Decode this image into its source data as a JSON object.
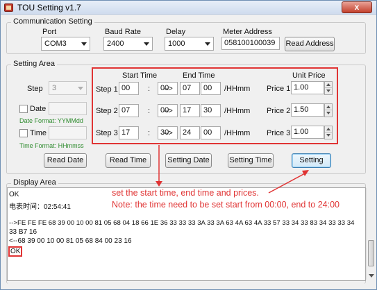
{
  "window": {
    "title": "TOU Setting v1.7",
    "close_label": "x"
  },
  "communication": {
    "legend": "Communication Setting",
    "port_label": "Port",
    "port_value": "COM3",
    "baud_label": "Baud Rate",
    "baud_value": "2400",
    "delay_label": "Delay",
    "delay_value": "1000",
    "meter_label": "Meter Address",
    "meter_value": "058100100039",
    "read_address_label": "Read Address"
  },
  "setting_area": {
    "legend": "Setting Area",
    "step_label": "Step",
    "step_value": "3",
    "date_label": "Date",
    "date_format": "Date Format: YYMMdd",
    "time_label": "Time",
    "time_format": "Time Format: HHmmss",
    "start_time_header": "Start Time",
    "end_time_header": "End Time",
    "unit_price_header": "Unit Price",
    "separator": ":",
    "arrow": "-->",
    "unit": "/HHmm",
    "steps": [
      {
        "label": "Step 1",
        "start_h": "00",
        "start_m": "00",
        "end_h": "07",
        "end_m": "00",
        "price_label": "Price 1",
        "price": "1.00"
      },
      {
        "label": "Step 2",
        "start_h": "07",
        "start_m": "00",
        "end_h": "17",
        "end_m": "30",
        "price_label": "Price 2",
        "price": "1.50"
      },
      {
        "label": "Step 3",
        "start_h": "17",
        "start_m": "30",
        "end_h": "24",
        "end_m": "00",
        "price_label": "Price 3",
        "price": "1.00"
      }
    ],
    "buttons": {
      "read_date": "Read Date",
      "read_time": "Read Time",
      "setting_date": "Setting Date",
      "setting_time": "Setting Time",
      "setting": "Setting"
    }
  },
  "display": {
    "legend": "Display Area",
    "lines": [
      "OK",
      "电表时间：02:54:41",
      "",
      "-->FE FE FE 68 39 00 10 00 81 05 68 04 18 66 1E 36 33 33 33 3A 33 3A 63 4A 63 4A 33 57 33 34 33 83 34 33 33 34",
      "33 B7 16",
      "<--68 39 00 10 00 81 05 68 84 00 23 16",
      "OK"
    ]
  },
  "annotation": {
    "line1": "set the start time, end time and prices.",
    "line2": "Note: the time need to be set start from 00:00, end to 24:00"
  },
  "colors": {
    "highlight_red": "#e03434",
    "format_green": "#2e8b2e"
  }
}
